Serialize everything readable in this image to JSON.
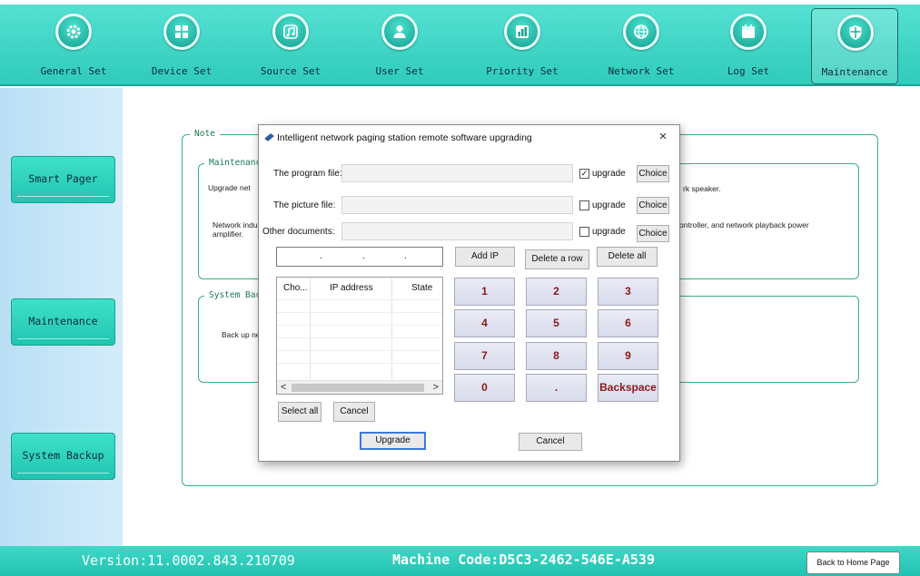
{
  "toolbar": {
    "items": [
      {
        "label": "General Set",
        "icon": "gear-icon"
      },
      {
        "label": "Device Set",
        "icon": "grid-icon"
      },
      {
        "label": "Source Set",
        "icon": "music-note-icon"
      },
      {
        "label": "User Set",
        "icon": "user-icon"
      },
      {
        "label": "Priority Set",
        "icon": "bar-chart-icon"
      },
      {
        "label": "Network Set",
        "icon": "globe-icon"
      },
      {
        "label": "Log Set",
        "icon": "calendar-icon"
      },
      {
        "label": "Maintenance",
        "icon": "shield-icon"
      }
    ],
    "active": "Maintenance"
  },
  "sidebar": {
    "items": [
      {
        "label": "Smart Pager"
      },
      {
        "label": "Maintenance"
      },
      {
        "label": "System Backup"
      }
    ]
  },
  "background": {
    "note_legend": "Note",
    "maintenance_legend": "Maintenanc",
    "maintenance_line1_left": "Upgrade net",
    "maintenance_line1_right": "rk speaker.",
    "maintenance_line2_left_a": "Network indu",
    "maintenance_line2_left_b": "amplifier.",
    "maintenance_line2_right": "ontroller, and network playback power",
    "backup_legend": "System Bac",
    "backup_text": "Back up ne"
  },
  "dialog": {
    "title": "Intelligent network paging station remote software upgrading",
    "close_label": "×",
    "program_file": {
      "label": "The program file:",
      "value": "",
      "checked": true,
      "check_label": "upgrade",
      "button": "Choice"
    },
    "picture_file": {
      "label": "The picture file:",
      "value": "",
      "checked": false,
      "check_label": "upgrade",
      "button": "Choice"
    },
    "other_documents": {
      "label": "Other documents:",
      "value": "",
      "checked": false,
      "check_label": "upgrade",
      "button": "Choice"
    },
    "ip_dots": [
      ".",
      ".",
      "."
    ],
    "add_ip": "Add IP",
    "delete_row": "Delete a row",
    "delete_all": "Delete all",
    "table": {
      "columns": [
        "Cho...",
        "IP address",
        "State"
      ],
      "rows": []
    },
    "scroll_left": "<",
    "scroll_right": ">",
    "select_all": "Select all",
    "cancel_small": "Cancel",
    "keypad": [
      "1",
      "2",
      "3",
      "4",
      "5",
      "6",
      "7",
      "8",
      "9",
      "0",
      ".",
      "Backspace"
    ],
    "upgrade": "Upgrade",
    "cancel": "Cancel"
  },
  "footer": {
    "version": "Version:11.0002.843.210709",
    "machine_code": "Machine Code:D5C3-2462-546E-A539",
    "home_button": "Back to Home Page"
  },
  "colors": {
    "toolbar": "#2fcbbb",
    "sidebar": "#c7e7f7",
    "border_green": "#33b37a",
    "key_text": "#8b1a1a"
  }
}
